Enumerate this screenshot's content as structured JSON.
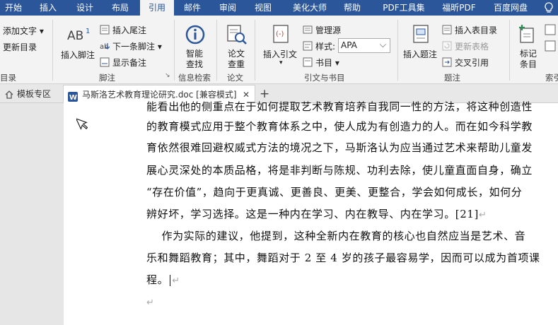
{
  "tabs": {
    "start": "开始",
    "insert": "插入",
    "design": "设计",
    "layout": "布局",
    "references": "引用",
    "mailings": "邮件",
    "review": "审阅",
    "view": "视图",
    "meihua": "美化大师",
    "help": "帮助",
    "pdf_tools": "PDF工具集",
    "foxit": "福昕PDF",
    "baidu": "百度网盘"
  },
  "ribbon": {
    "add_text": "添加文字",
    "update_toc": "更新目录",
    "toc_group_label": "目录",
    "insert_footnote": "插入脚注",
    "insert_endnote": "插入尾注",
    "next_footnote": "下一条脚注",
    "show_notes": "显示备注",
    "footnote_group_label": "脚注",
    "smart_lookup_line1": "智能",
    "smart_lookup_line2": "查找",
    "info_group_label": "信息检索",
    "thesis_line1": "论文",
    "thesis_line2": "查重",
    "thesis_group_label": "论文",
    "insert_citation": "插入引文",
    "manage_sources": "管理源",
    "style_label": "样式:",
    "style_value": "APA",
    "bibliography": "书目",
    "citation_group_label": "引文与书目",
    "insert_caption": "插入题注",
    "insert_table_of_figures": "插入表目录",
    "update_table": "更新表格",
    "cross_reference": "交叉引用",
    "caption_group_label": "题注",
    "mark_entry_line1": "标记",
    "mark_entry_line2": "条目",
    "index_group_label": "索引"
  },
  "doc_tabs": {
    "template_zone": "模板专区",
    "document": "马斯洛艺术教育理论研究.doc [兼容模式]",
    "close": "✕",
    "new": "+"
  },
  "document": {
    "lines": [
      "能看出他的侧重点在于如何提取艺术教育培养自我同一性的方法，将这种创造性",
      "的教育模式应用于整个教育体系之中，使人成为有创造力的人。而在如今科学教",
      "育依然很难回避权威式方法的境况之下，马斯洛认为应当通过艺术来帮助儿童发",
      "展心灵深处的本质品格，将是非判断与陈规、功利去除，使儿童直面自身，确立",
      "“存在价值”，趋向于更真诚、更善良、更美、更整合，学会如何成长，如何分",
      "辨好坏，学习选择。这是一种内在学习、内在教导、内在学习。[21]",
      "    作为实际的建议，他提到，这种全新内在教育的核心也自然应当是艺术、音",
      "乐和舞蹈教育；其中，舞蹈对于 2 至 4 岁的孩子最容易学，因而可以成为首项课",
      "程。"
    ],
    "para_mark": "↵"
  }
}
